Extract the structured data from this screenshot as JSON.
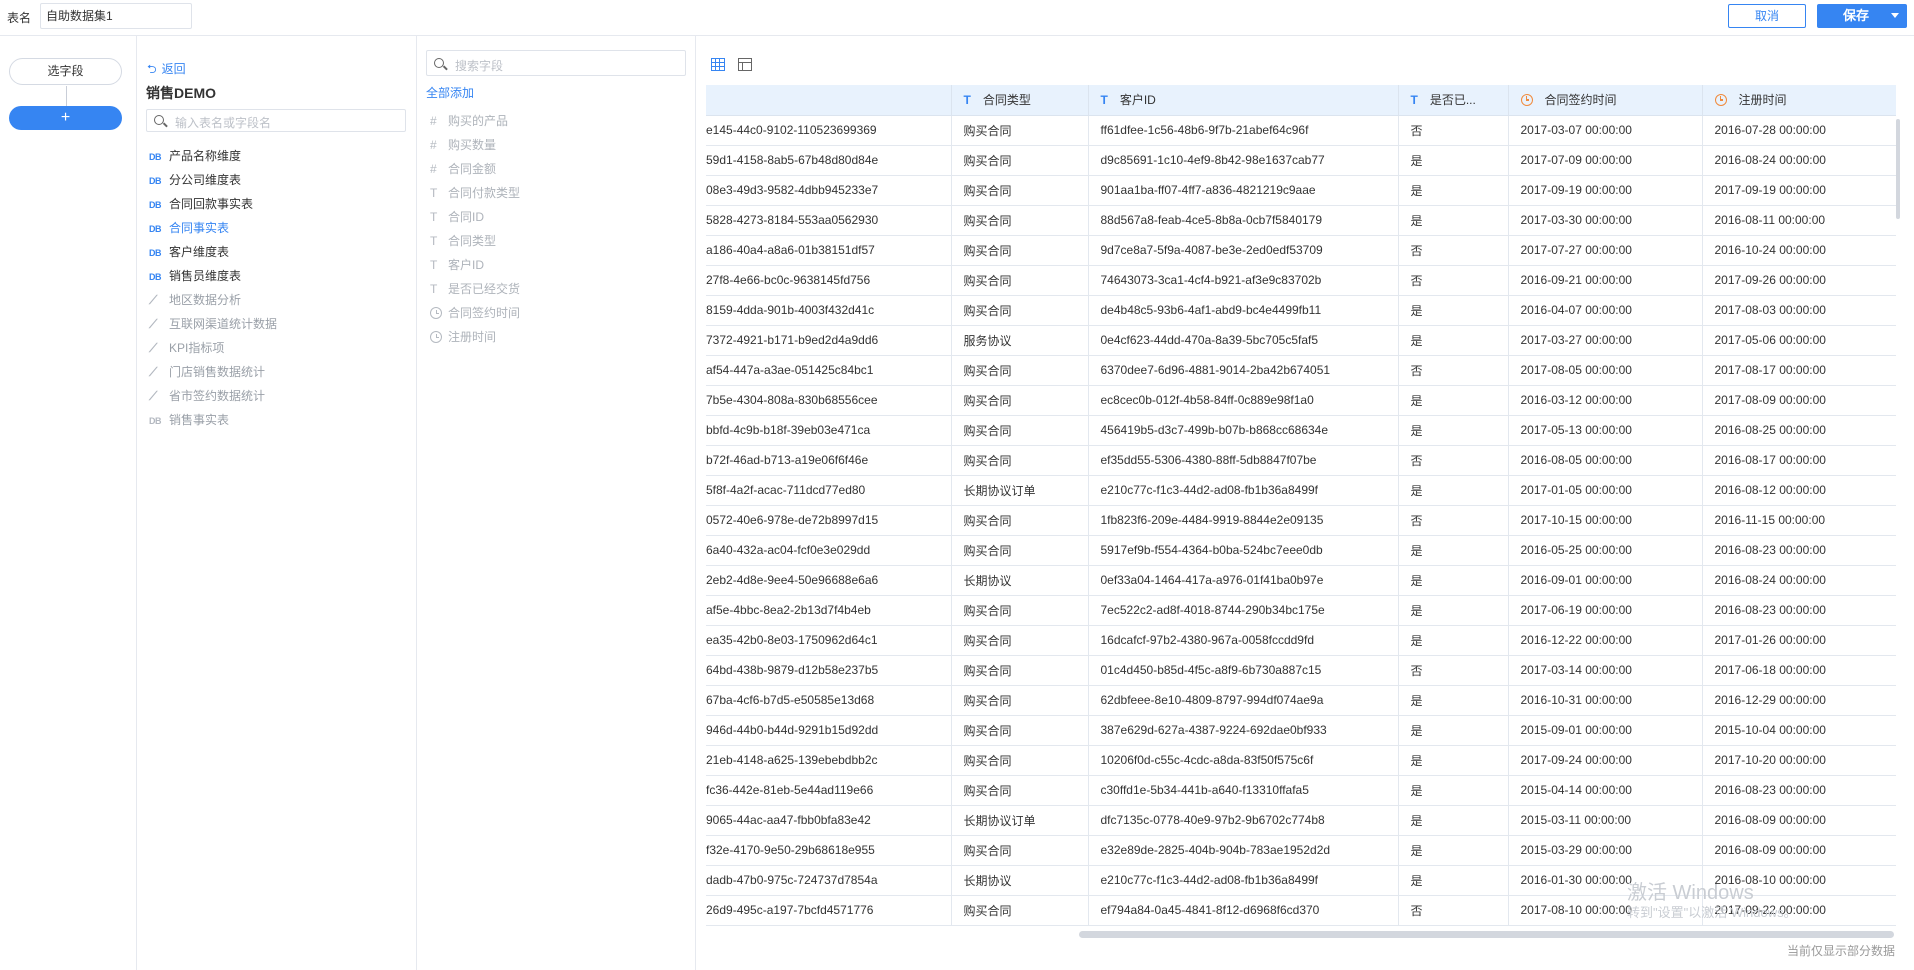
{
  "topbar": {
    "name_label": "表名",
    "name_value": "自助数据集1",
    "cancel": "取消",
    "save": "保存"
  },
  "steps": {
    "select_fields": "选字段",
    "add": "+"
  },
  "tables_panel": {
    "back": "返回",
    "package_title": "销售DEMO",
    "search_placeholder": "输入表名或字段名",
    "items": [
      {
        "icon": "DB",
        "label": "产品名称维度",
        "state": "normal"
      },
      {
        "icon": "DB",
        "label": "分公司维度表",
        "state": "normal"
      },
      {
        "icon": "DB",
        "label": "合同回款事实表",
        "state": "normal"
      },
      {
        "icon": "DB",
        "label": "合同事实表",
        "state": "active"
      },
      {
        "icon": "DB",
        "label": "客户维度表",
        "state": "normal"
      },
      {
        "icon": "DB",
        "label": "销售员维度表",
        "state": "normal"
      },
      {
        "icon": "chart-icon",
        "label": "地区数据分析",
        "state": "dim"
      },
      {
        "icon": "chart-icon",
        "label": "互联网渠道统计数据",
        "state": "dim"
      },
      {
        "icon": "chart-icon",
        "label": "KPI指标项",
        "state": "dim"
      },
      {
        "icon": "chart-icon",
        "label": "门店销售数据统计",
        "state": "dim"
      },
      {
        "icon": "chart-icon",
        "label": "省市签约数据统计",
        "state": "dim"
      },
      {
        "icon": "DB",
        "label": "销售事实表",
        "state": "dim"
      }
    ]
  },
  "fields_panel": {
    "search_placeholder": "搜索字段",
    "add_all": "全部添加",
    "items": [
      {
        "type": "#",
        "label": "购买的产品"
      },
      {
        "type": "#",
        "label": "购买数量"
      },
      {
        "type": "#",
        "label": "合同金额"
      },
      {
        "type": "T",
        "label": "合同付款类型"
      },
      {
        "type": "T",
        "label": "合同ID"
      },
      {
        "type": "T",
        "label": "合同类型"
      },
      {
        "type": "T",
        "label": "客户ID"
      },
      {
        "type": "T",
        "label": "是否已经交货"
      },
      {
        "type": "clock",
        "label": "合同签约时间"
      },
      {
        "type": "clock",
        "label": "注册时间"
      }
    ]
  },
  "preview": {
    "columns": [
      {
        "type": "",
        "label": ""
      },
      {
        "type": "T",
        "label": "合同类型"
      },
      {
        "type": "T",
        "label": "客户ID"
      },
      {
        "type": "T",
        "label": "是否已..."
      },
      {
        "type": "clock",
        "label": "合同签约时间"
      },
      {
        "type": "clock",
        "label": "注册时间"
      }
    ],
    "rows": [
      [
        "e145-44c0-9102-110523699369",
        "购买合同",
        "ff61dfee-1c56-48b6-9f7b-21abef64c96f",
        "否",
        "2017-03-07 00:00:00",
        "2016-07-28 00:00:00"
      ],
      [
        "59d1-4158-8ab5-67b48d80d84e",
        "购买合同",
        "d9c85691-1c10-4ef9-8b42-98e1637cab77",
        "是",
        "2017-07-09 00:00:00",
        "2016-08-24 00:00:00"
      ],
      [
        "08e3-49d3-9582-4dbb945233e7",
        "购买合同",
        "901aa1ba-ff07-4ff7-a836-4821219c9aae",
        "是",
        "2017-09-19 00:00:00",
        "2017-09-19 00:00:00"
      ],
      [
        "5828-4273-8184-553aa0562930",
        "购买合同",
        "88d567a8-feab-4ce5-8b8a-0cb7f5840179",
        "是",
        "2017-03-30 00:00:00",
        "2016-08-11 00:00:00"
      ],
      [
        "a186-40a4-a8a6-01b38151df57",
        "购买合同",
        "9d7ce8a7-5f9a-4087-be3e-2ed0edf53709",
        "否",
        "2017-07-27 00:00:00",
        "2016-10-24 00:00:00"
      ],
      [
        "27f8-4e66-bc0c-9638145fd756",
        "购买合同",
        "74643073-3ca1-4cf4-b921-af3e9c83702b",
        "否",
        "2016-09-21 00:00:00",
        "2017-09-26 00:00:00"
      ],
      [
        "8159-4dda-901b-4003f432d41c",
        "购买合同",
        "de4b48c5-93b6-4af1-abd9-bc4e4499fb11",
        "是",
        "2016-04-07 00:00:00",
        "2017-08-03 00:00:00"
      ],
      [
        "7372-4921-b171-b9ed2d4a9dd6",
        "服务协议",
        "0e4cf623-44dd-470a-8a39-5bc705c5faf5",
        "是",
        "2017-03-27 00:00:00",
        "2017-05-06 00:00:00"
      ],
      [
        "af54-447a-a3ae-051425c84bc1",
        "购买合同",
        "6370dee7-6d96-4881-9014-2ba42b674051",
        "否",
        "2017-08-05 00:00:00",
        "2017-08-17 00:00:00"
      ],
      [
        "7b5e-4304-808a-830b68556cee",
        "购买合同",
        "ec8cec0b-012f-4b58-84ff-0c889e98f1a0",
        "是",
        "2016-03-12 00:00:00",
        "2017-08-09 00:00:00"
      ],
      [
        "bbfd-4c9b-b18f-39eb03e471ca",
        "购买合同",
        "456419b5-d3c7-499b-b07b-b868cc68634e",
        "是",
        "2017-05-13 00:00:00",
        "2016-08-25 00:00:00"
      ],
      [
        "b72f-46ad-b713-a19e06f6f46e",
        "购买合同",
        "ef35dd55-5306-4380-88ff-5db8847f07be",
        "否",
        "2016-08-05 00:00:00",
        "2016-08-17 00:00:00"
      ],
      [
        "5f8f-4a2f-acac-711dcd77ed80",
        "长期协议订单",
        "e210c77c-f1c3-44d2-ad08-fb1b36a8499f",
        "是",
        "2017-01-05 00:00:00",
        "2016-08-12 00:00:00"
      ],
      [
        "0572-40e6-978e-de72b8997d15",
        "购买合同",
        "1fb823f6-209e-4484-9919-8844e2e09135",
        "否",
        "2017-10-15 00:00:00",
        "2016-11-15 00:00:00"
      ],
      [
        "6a40-432a-ac04-fcf0e3e029dd",
        "购买合同",
        "5917ef9b-f554-4364-b0ba-524bc7eee0db",
        "是",
        "2016-05-25 00:00:00",
        "2016-08-23 00:00:00"
      ],
      [
        "2eb2-4d8e-9ee4-50e96688e6a6",
        "长期协议",
        "0ef33a04-1464-417a-a976-01f41ba0b97e",
        "是",
        "2016-09-01 00:00:00",
        "2016-08-24 00:00:00"
      ],
      [
        "af5e-4bbc-8ea2-2b13d7f4b4eb",
        "购买合同",
        "7ec522c2-ad8f-4018-8744-290b34bc175e",
        "是",
        "2017-06-19 00:00:00",
        "2016-08-23 00:00:00"
      ],
      [
        "ea35-42b0-8e03-1750962d64c1",
        "购买合同",
        "16dcafcf-97b2-4380-967a-0058fccdd9fd",
        "是",
        "2016-12-22 00:00:00",
        "2017-01-26 00:00:00"
      ],
      [
        "64bd-438b-9879-d12b58e237b5",
        "购买合同",
        "01c4d450-b85d-4f5c-a8f9-6b730a887c15",
        "否",
        "2017-03-14 00:00:00",
        "2017-06-18 00:00:00"
      ],
      [
        "67ba-4cf6-b7d5-e50585e13d68",
        "购买合同",
        "62dbfeee-8e10-4809-8797-994df074ae9a",
        "是",
        "2016-10-31 00:00:00",
        "2016-12-29 00:00:00"
      ],
      [
        "946d-44b0-b44d-9291b15d92dd",
        "购买合同",
        "387e629d-627a-4387-9224-692dae0bf933",
        "是",
        "2015-09-01 00:00:00",
        "2015-10-04 00:00:00"
      ],
      [
        "21eb-4148-a625-139ebebdbb2c",
        "购买合同",
        "10206f0d-c55c-4cdc-a8da-83f50f575c6f",
        "是",
        "2017-09-24 00:00:00",
        "2017-10-20 00:00:00"
      ],
      [
        "fc36-442e-81eb-5e44ad119e66",
        "购买合同",
        "c30ffd1e-5b34-441b-a640-f13310ffafa5",
        "是",
        "2015-04-14 00:00:00",
        "2016-08-23 00:00:00"
      ],
      [
        "9065-44ac-aa47-fbb0bfa83e42",
        "长期协议订单",
        "dfc7135c-0778-40e9-97b2-9b6702c774b8",
        "是",
        "2015-03-11 00:00:00",
        "2016-08-09 00:00:00"
      ],
      [
        "f32e-4170-9e50-29b68618e955",
        "购买合同",
        "e32e89de-2825-404b-904b-783ae1952d2d",
        "是",
        "2015-03-29 00:00:00",
        "2016-08-09 00:00:00"
      ],
      [
        "dadb-47b0-975c-724737d7854a",
        "长期协议",
        "e210c77c-f1c3-44d2-ad08-fb1b36a8499f",
        "是",
        "2016-01-30 00:00:00",
        "2016-08-10 00:00:00"
      ],
      [
        "26d9-495c-a197-7bcfd4571776",
        "购买合同",
        "ef794a84-0a45-4841-8f12-d6968f6cd370",
        "否",
        "2017-08-10 00:00:00",
        "2017-09-22 00:00:00"
      ]
    ],
    "partial_note": "当前仅显示部分数据",
    "watermark": "激活 Windows",
    "watermark_sub": "转到\"设置\"以激活 Windows。"
  }
}
